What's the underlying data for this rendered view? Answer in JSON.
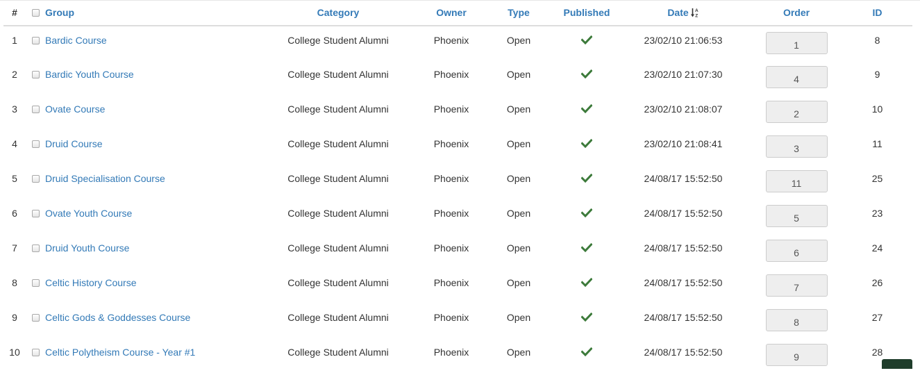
{
  "headers": {
    "num": "#",
    "group": "Group",
    "category": "Category",
    "owner": "Owner",
    "type": "Type",
    "published": "Published",
    "date": "Date",
    "order": "Order",
    "id": "ID"
  },
  "icons": {
    "sort": "sort-alpha-asc-icon",
    "published": "check-icon"
  },
  "colors": {
    "link": "#337ab7",
    "check": "#3c7a3a"
  },
  "rows": [
    {
      "num": "1",
      "group": "Bardic Course",
      "category": "College Student Alumni",
      "owner": "Phoenix",
      "type": "Open",
      "date": "23/02/10 21:06:53",
      "order": "1",
      "id": "8"
    },
    {
      "num": "2",
      "group": "Bardic Youth Course",
      "category": "College Student Alumni",
      "owner": "Phoenix",
      "type": "Open",
      "date": "23/02/10 21:07:30",
      "order": "4",
      "id": "9"
    },
    {
      "num": "3",
      "group": "Ovate Course",
      "category": "College Student Alumni",
      "owner": "Phoenix",
      "type": "Open",
      "date": "23/02/10 21:08:07",
      "order": "2",
      "id": "10"
    },
    {
      "num": "4",
      "group": "Druid Course",
      "category": "College Student Alumni",
      "owner": "Phoenix",
      "type": "Open",
      "date": "23/02/10 21:08:41",
      "order": "3",
      "id": "11"
    },
    {
      "num": "5",
      "group": "Druid Specialisation Course",
      "category": "College Student Alumni",
      "owner": "Phoenix",
      "type": "Open",
      "date": "24/08/17 15:52:50",
      "order": "11",
      "id": "25"
    },
    {
      "num": "6",
      "group": "Ovate Youth Course",
      "category": "College Student Alumni",
      "owner": "Phoenix",
      "type": "Open",
      "date": "24/08/17 15:52:50",
      "order": "5",
      "id": "23"
    },
    {
      "num": "7",
      "group": "Druid Youth Course",
      "category": "College Student Alumni",
      "owner": "Phoenix",
      "type": "Open",
      "date": "24/08/17 15:52:50",
      "order": "6",
      "id": "24"
    },
    {
      "num": "8",
      "group": "Celtic History Course",
      "category": "College Student Alumni",
      "owner": "Phoenix",
      "type": "Open",
      "date": "24/08/17 15:52:50",
      "order": "7",
      "id": "26"
    },
    {
      "num": "9",
      "group": "Celtic Gods & Goddesses Course",
      "category": "College Student Alumni",
      "owner": "Phoenix",
      "type": "Open",
      "date": "24/08/17 15:52:50",
      "order": "8",
      "id": "27"
    },
    {
      "num": "10",
      "group": "Celtic Polytheism Course - Year #1",
      "category": "College Student Alumni",
      "owner": "Phoenix",
      "type": "Open",
      "date": "24/08/17 15:52:50",
      "order": "9",
      "id": "28"
    }
  ]
}
